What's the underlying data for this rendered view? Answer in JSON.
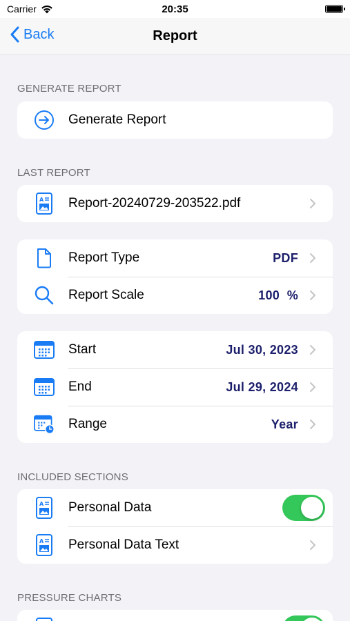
{
  "status": {
    "carrier": "Carrier",
    "time": "20:35"
  },
  "nav": {
    "back_label": "Back",
    "title": "Report"
  },
  "sections": {
    "generate": {
      "header": "GENERATE REPORT",
      "button_label": "Generate Report"
    },
    "last_report": {
      "header": "LAST REPORT",
      "file_name": "Report-20240729-203522.pdf"
    },
    "report_settings": {
      "type_label": "Report Type",
      "type_value": "PDF",
      "scale_label": "Report Scale",
      "scale_value": "100  %"
    },
    "date_range": {
      "start_label": "Start",
      "start_value": "Jul 30, 2023",
      "end_label": "End",
      "end_value": "Jul 29, 2024",
      "range_label": "Range",
      "range_value": "Year"
    },
    "included": {
      "header": "INCLUDED SECTIONS",
      "personal_data_label": "Personal Data",
      "personal_data_text_label": "Personal Data Text"
    },
    "pressure_charts": {
      "header": "PRESSURE CHARTS"
    }
  },
  "colors": {
    "accent": "#1a7cf5",
    "value_text": "#1c1f6b",
    "toggle_on": "#34c759",
    "background": "#f2f2f7"
  }
}
